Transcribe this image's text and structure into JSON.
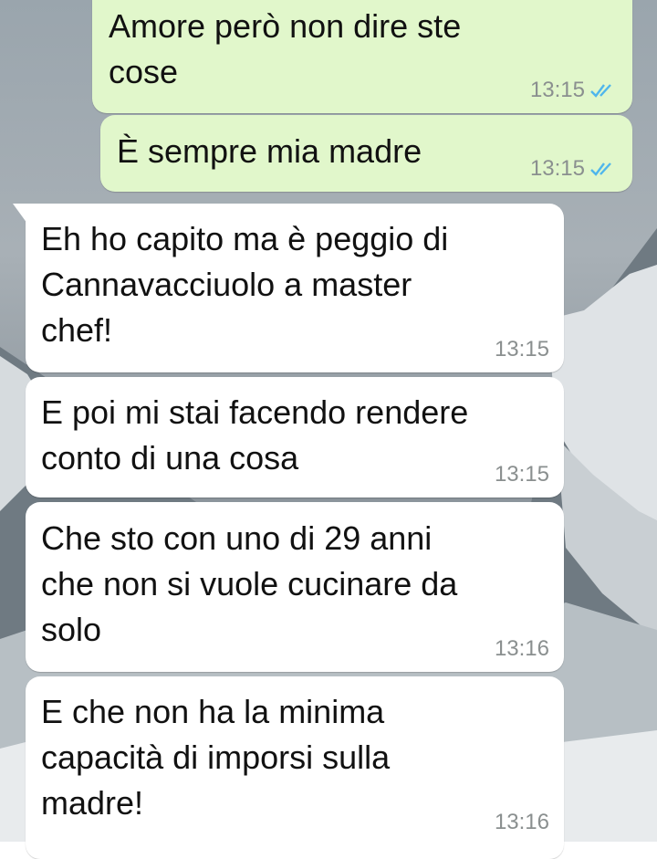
{
  "conversation": {
    "messages": [
      {
        "direction": "outgoing",
        "text": "Amore però non dire ste\ncose",
        "time": "13:15",
        "status": "read"
      },
      {
        "direction": "outgoing",
        "text": "È sempre mia madre",
        "time": "13:15",
        "status": "read"
      },
      {
        "direction": "incoming",
        "text": "Eh ho capito ma è peggio di\nCannavacciuolo a master\nchef!",
        "time": "13:15"
      },
      {
        "direction": "incoming",
        "text": "E poi mi stai facendo rendere\nconto di una cosa",
        "time": "13:15"
      },
      {
        "direction": "incoming",
        "text": "Che sto con uno di 29 anni\nche non si vuole cucinare da\nsolo",
        "time": "13:16"
      },
      {
        "direction": "incoming",
        "text": "E che non ha la minima\ncapacità di imporsi sulla\nmadre!",
        "time": "13:16"
      }
    ]
  },
  "colors": {
    "outgoing_bubble": "#e1f7cb",
    "incoming_bubble": "#ffffff",
    "read_ticks": "#4fb6ec",
    "timestamp": "#8a8f8f"
  },
  "icons": {
    "read_receipt": "double-check-icon",
    "background": "mountain-wallpaper"
  }
}
